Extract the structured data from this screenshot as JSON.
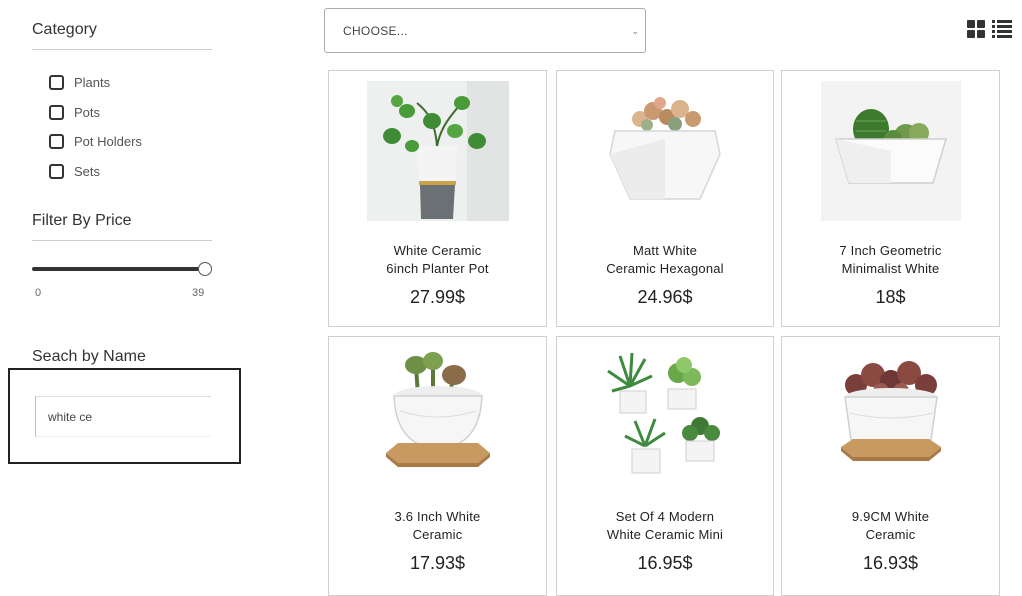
{
  "sidebar": {
    "category_title": "Category",
    "categories": [
      "Plants",
      "Pots",
      "Pot Holders",
      "Sets"
    ],
    "price_title": "Filter By Price",
    "price_min": "0",
    "price_max": "39",
    "price_value": 39,
    "search_title": "Seach by Name",
    "search_value": "white ce"
  },
  "topbar": {
    "select_value": "CHOOSE...",
    "grid_icon": "grid-view-icon",
    "list_icon": "list-view-icon"
  },
  "products": [
    {
      "line1": "White Ceramic",
      "line2": "6inch Planter Pot",
      "price": "27.99$"
    },
    {
      "line1": "Matt White",
      "line2": "Ceramic Hexagonal",
      "price": "24.96$"
    },
    {
      "line1": "7 Inch Geometric",
      "line2": "Minimalist White",
      "price": "18$"
    },
    {
      "line1": "3.6 Inch White",
      "line2": "Ceramic",
      "price": "17.93$"
    },
    {
      "line1": "Set Of 4 Modern",
      "line2": "White Ceramic Mini",
      "price": "16.95$"
    },
    {
      "line1": "9.9CM White",
      "line2": "Ceramic",
      "price": "16.93$"
    }
  ]
}
